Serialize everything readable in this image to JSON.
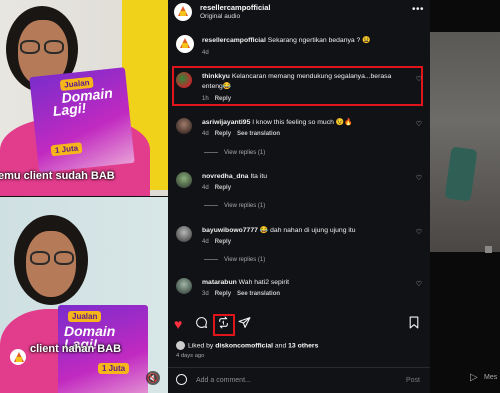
{
  "reel": {
    "top_caption": "emu client sudah BAB",
    "bottom_caption": "client nahan BAB",
    "flyer_badge": "Jualan",
    "flyer_title_1": "Domain",
    "flyer_title_2": "Lagi!",
    "flyer_price": "1 Juta",
    "mute_icon": "speaker-muted-icon"
  },
  "post": {
    "username": "resellercampofficial",
    "audio": "Original audio",
    "menu_icon": "more-horizontal-icon"
  },
  "comments": [
    {
      "user": "resellercampofficial",
      "text": "Sekarang ngertikan bedanya ? 😫",
      "age": "4d",
      "reply": "",
      "replies": "",
      "translation": ""
    },
    {
      "user": "thinkkyu",
      "text": "Kelancaran memang mendukung segalanya...berasa enteng😂",
      "age": "1h",
      "reply": "Reply",
      "replies": "",
      "translation": ""
    },
    {
      "user": "asriwijayanti95",
      "text": "I know this feeling so much 😉🔥",
      "age": "4d",
      "reply": "Reply",
      "replies": "View replies (1)",
      "translation": "See translation"
    },
    {
      "user": "novredha_dna",
      "text": "Ita itu",
      "age": "4d",
      "reply": "Reply",
      "replies": "View replies (1)",
      "translation": ""
    },
    {
      "user": "bayuwibowo7777",
      "text": "😂 dah nahan di ujung ujung itu",
      "age": "4d",
      "reply": "Reply",
      "replies": "View replies (1)",
      "translation": ""
    },
    {
      "user": "matarabun",
      "text": "Wah hati2 sepirit",
      "age": "3d",
      "reply": "Reply",
      "replies": "",
      "translation": "See translation"
    }
  ],
  "actions": {
    "like_icon": "heart-filled-icon",
    "comment_icon": "comment-icon",
    "repost_icon": "repost-icon",
    "share_icon": "send-icon",
    "save_icon": "bookmark-icon"
  },
  "liked_by": {
    "prefix": "Liked by ",
    "user": "diskoncomofficial",
    "mid": " and ",
    "others": "13 others"
  },
  "time_ago": "4 days ago",
  "composer": {
    "placeholder": "Add a comment...",
    "post_label": "Post"
  },
  "right_panel": {
    "messages_label": "Mes"
  },
  "colors": {
    "highlight": "#e0141b",
    "heart": "#ff3040",
    "panel_bg": "#111215"
  }
}
